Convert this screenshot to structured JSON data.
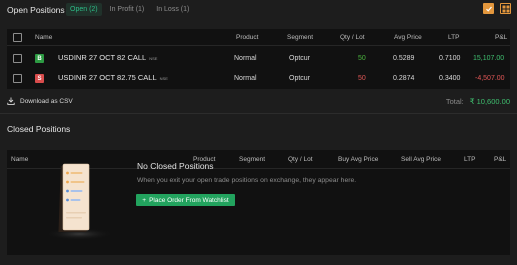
{
  "open_positions": {
    "title": "Open Positions :",
    "filters": [
      {
        "label": "Open (2)",
        "active": true
      },
      {
        "label": "In Profit (1)",
        "active": false
      },
      {
        "label": "In Loss (1)",
        "active": false
      }
    ],
    "icons": [
      "edit-checkbox-icon",
      "grid-view-icon"
    ],
    "columns": [
      "Name",
      "Product",
      "Segment",
      "Qty / Lot",
      "Avg Price",
      "LTP",
      "P&L"
    ],
    "rows": [
      {
        "side": "B",
        "name": "USDINR 27 OCT 82 CALL",
        "exchange": "NSE",
        "product": "Normal",
        "segment": "Optcur",
        "qty": "50",
        "avg_price": "0.5289",
        "ltp": "0.7100",
        "pl": "15,107.00"
      },
      {
        "side": "S",
        "name": "USDINR 27 OCT 82.75 CALL",
        "exchange": "NSE",
        "product": "Normal",
        "segment": "Optcur",
        "qty": "50",
        "avg_price": "0.2874",
        "ltp": "0.3400",
        "pl": "-4,507.00"
      }
    ],
    "download_label": "Download as CSV",
    "total_label": "Total:",
    "total_value": "₹ 10,600.00"
  },
  "closed_positions": {
    "title": "Closed Positions",
    "columns": [
      "Name",
      "Product",
      "Segment",
      "Qty / Lot",
      "Buy Avg Price",
      "Sell Avg Price",
      "LTP",
      "P&L"
    ],
    "empty_title": "No Closed Positions",
    "empty_subtitle": "When you exit your open trade positions on exchange, they appear here.",
    "button_label": "Place Order From Watchlist"
  },
  "colors": {
    "accent_green": "#22a35e",
    "profit": "#3fbf6f",
    "loss": "#e05656",
    "icon_orange": "#e3973d"
  }
}
